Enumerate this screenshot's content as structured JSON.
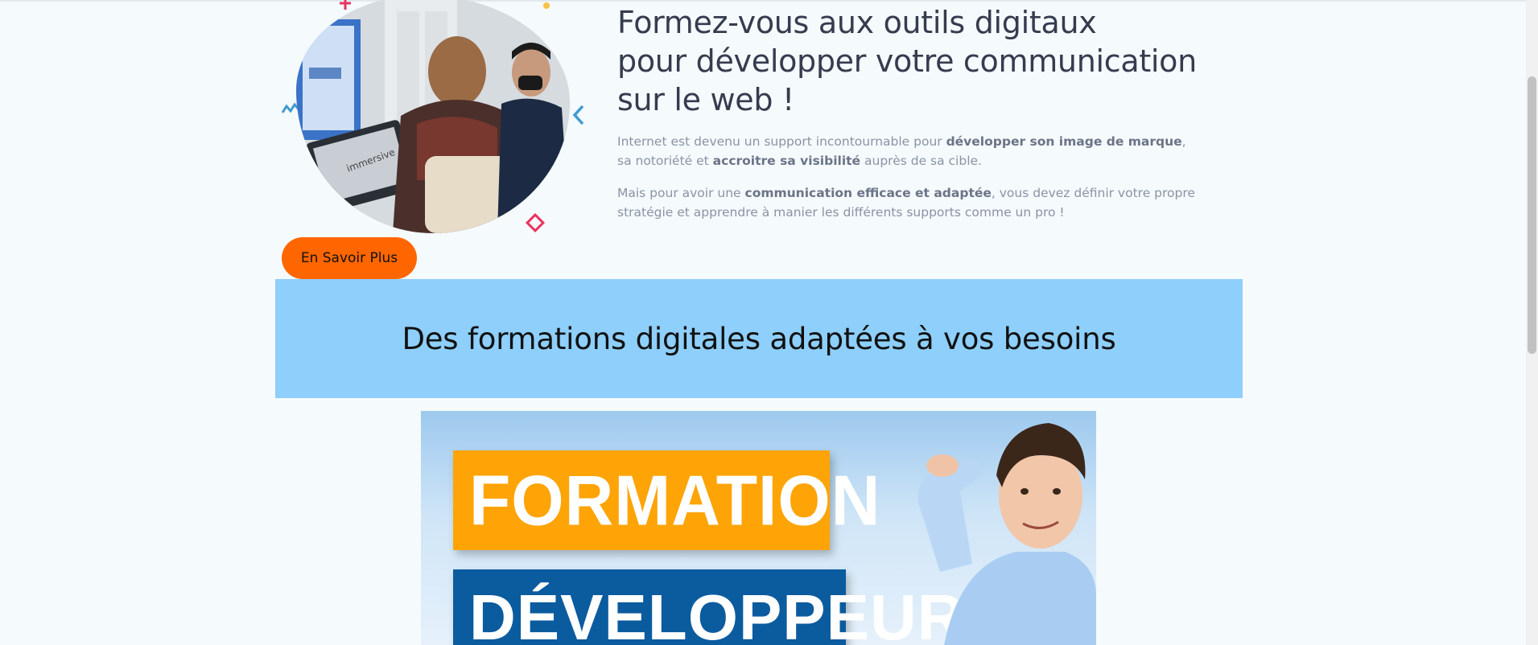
{
  "hero": {
    "title_lines": [
      "Formez-vous aux outils digitaux",
      "pour développer votre communication",
      "sur le web !"
    ],
    "paragraph1": {
      "t1": "Internet est devenu un support incontournable pour ",
      "b1": "développer son image de marque",
      "t2": ",",
      "t3": "sa notoriété et ",
      "b2": "accroitre sa visibilité",
      "t4": " auprès de sa cible."
    },
    "paragraph2": {
      "t1": "Mais pour avoir une ",
      "b1": "communication efficace et adaptée",
      "t2": ", vous devez définir votre propre",
      "t3": "stratégie et apprendre à manier les différents supports comme un pro !"
    },
    "laptop_sticker": "immersive",
    "cta_label": "En Savoir Plus"
  },
  "band": {
    "title": "Des formations digitales adaptées à vos besoins"
  },
  "banner": {
    "label1": "FORMATION",
    "label2": "DÉVELOPPEUR"
  },
  "colors": {
    "accent_orange": "#ff6600",
    "band_blue": "#8ecffb",
    "banner_orange": "#ffa407",
    "banner_blue": "#0b5b9f",
    "deco_pink": "#e8345e",
    "deco_blue": "#3f9bd0",
    "deco_yellow": "#f7c343"
  }
}
